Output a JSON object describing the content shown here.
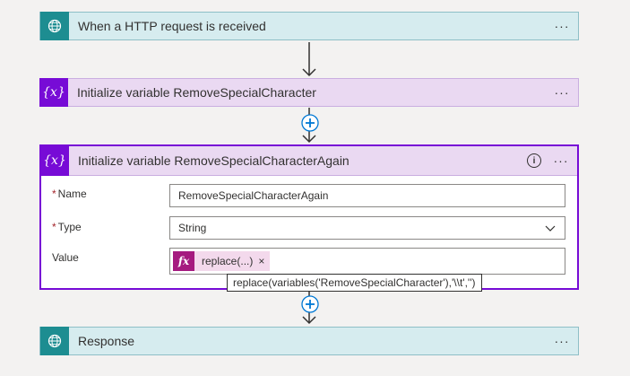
{
  "steps": {
    "trigger": {
      "title": "When a HTTP request is received",
      "icon": "globe-icon",
      "menu": "···"
    },
    "init1": {
      "title": "Initialize variable RemoveSpecialCharacter",
      "icon": "variable-icon",
      "icon_glyph": "{x}",
      "menu": "···"
    },
    "init2": {
      "title": "Initialize variable RemoveSpecialCharacterAgain",
      "icon": "variable-icon",
      "icon_glyph": "{x}",
      "info_glyph": "i",
      "menu": "···",
      "fields": {
        "name": {
          "label": "Name",
          "required": "*",
          "value": "RemoveSpecialCharacterAgain"
        },
        "type": {
          "label": "Type",
          "required": "*",
          "value": "String"
        },
        "value": {
          "label": "Value",
          "token_glyph": "fx",
          "token_label": "replace(...)",
          "token_remove": "×"
        }
      },
      "tooltip": "replace(variables('RemoveSpecialCharacter'),'\\\\t','')"
    },
    "response": {
      "title": "Response",
      "icon": "globe-icon",
      "menu": "···"
    }
  },
  "colors": {
    "http_accent": "#1d8d91",
    "variable_accent": "#770bd6",
    "expression_accent": "#a51a7f",
    "insert_button": "#0078d4"
  }
}
